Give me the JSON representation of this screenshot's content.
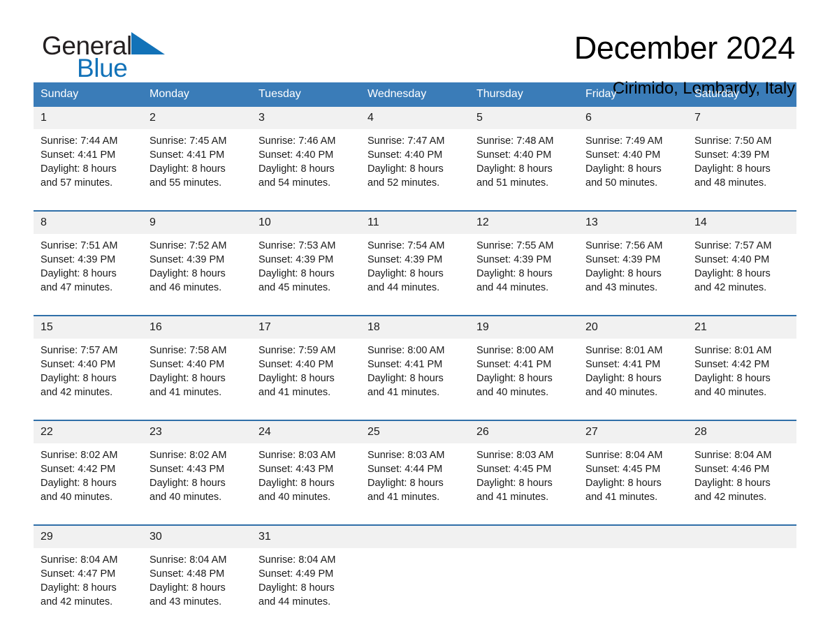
{
  "brand": {
    "name_part1": "General",
    "name_part2": "Blue",
    "mark": "triangle-logo",
    "accent_color": "#1272b8"
  },
  "header": {
    "title": "December 2024",
    "subtitle": "Cirimido, Lombardy, Italy"
  },
  "calendar": {
    "header_bg": "#3a7cb8",
    "daynum_bg": "#f1f1f1",
    "row_divider_color": "#2f6fa8",
    "weekday_headers": [
      "Sunday",
      "Monday",
      "Tuesday",
      "Wednesday",
      "Thursday",
      "Friday",
      "Saturday"
    ],
    "weeks": [
      [
        {
          "day": "1",
          "sunrise": "Sunrise: 7:44 AM",
          "sunset": "Sunset: 4:41 PM",
          "daylight_line1": "Daylight: 8 hours",
          "daylight_line2": "and 57 minutes."
        },
        {
          "day": "2",
          "sunrise": "Sunrise: 7:45 AM",
          "sunset": "Sunset: 4:41 PM",
          "daylight_line1": "Daylight: 8 hours",
          "daylight_line2": "and 55 minutes."
        },
        {
          "day": "3",
          "sunrise": "Sunrise: 7:46 AM",
          "sunset": "Sunset: 4:40 PM",
          "daylight_line1": "Daylight: 8 hours",
          "daylight_line2": "and 54 minutes."
        },
        {
          "day": "4",
          "sunrise": "Sunrise: 7:47 AM",
          "sunset": "Sunset: 4:40 PM",
          "daylight_line1": "Daylight: 8 hours",
          "daylight_line2": "and 52 minutes."
        },
        {
          "day": "5",
          "sunrise": "Sunrise: 7:48 AM",
          "sunset": "Sunset: 4:40 PM",
          "daylight_line1": "Daylight: 8 hours",
          "daylight_line2": "and 51 minutes."
        },
        {
          "day": "6",
          "sunrise": "Sunrise: 7:49 AM",
          "sunset": "Sunset: 4:40 PM",
          "daylight_line1": "Daylight: 8 hours",
          "daylight_line2": "and 50 minutes."
        },
        {
          "day": "7",
          "sunrise": "Sunrise: 7:50 AM",
          "sunset": "Sunset: 4:39 PM",
          "daylight_line1": "Daylight: 8 hours",
          "daylight_line2": "and 48 minutes."
        }
      ],
      [
        {
          "day": "8",
          "sunrise": "Sunrise: 7:51 AM",
          "sunset": "Sunset: 4:39 PM",
          "daylight_line1": "Daylight: 8 hours",
          "daylight_line2": "and 47 minutes."
        },
        {
          "day": "9",
          "sunrise": "Sunrise: 7:52 AM",
          "sunset": "Sunset: 4:39 PM",
          "daylight_line1": "Daylight: 8 hours",
          "daylight_line2": "and 46 minutes."
        },
        {
          "day": "10",
          "sunrise": "Sunrise: 7:53 AM",
          "sunset": "Sunset: 4:39 PM",
          "daylight_line1": "Daylight: 8 hours",
          "daylight_line2": "and 45 minutes."
        },
        {
          "day": "11",
          "sunrise": "Sunrise: 7:54 AM",
          "sunset": "Sunset: 4:39 PM",
          "daylight_line1": "Daylight: 8 hours",
          "daylight_line2": "and 44 minutes."
        },
        {
          "day": "12",
          "sunrise": "Sunrise: 7:55 AM",
          "sunset": "Sunset: 4:39 PM",
          "daylight_line1": "Daylight: 8 hours",
          "daylight_line2": "and 44 minutes."
        },
        {
          "day": "13",
          "sunrise": "Sunrise: 7:56 AM",
          "sunset": "Sunset: 4:39 PM",
          "daylight_line1": "Daylight: 8 hours",
          "daylight_line2": "and 43 minutes."
        },
        {
          "day": "14",
          "sunrise": "Sunrise: 7:57 AM",
          "sunset": "Sunset: 4:40 PM",
          "daylight_line1": "Daylight: 8 hours",
          "daylight_line2": "and 42 minutes."
        }
      ],
      [
        {
          "day": "15",
          "sunrise": "Sunrise: 7:57 AM",
          "sunset": "Sunset: 4:40 PM",
          "daylight_line1": "Daylight: 8 hours",
          "daylight_line2": "and 42 minutes."
        },
        {
          "day": "16",
          "sunrise": "Sunrise: 7:58 AM",
          "sunset": "Sunset: 4:40 PM",
          "daylight_line1": "Daylight: 8 hours",
          "daylight_line2": "and 41 minutes."
        },
        {
          "day": "17",
          "sunrise": "Sunrise: 7:59 AM",
          "sunset": "Sunset: 4:40 PM",
          "daylight_line1": "Daylight: 8 hours",
          "daylight_line2": "and 41 minutes."
        },
        {
          "day": "18",
          "sunrise": "Sunrise: 8:00 AM",
          "sunset": "Sunset: 4:41 PM",
          "daylight_line1": "Daylight: 8 hours",
          "daylight_line2": "and 41 minutes."
        },
        {
          "day": "19",
          "sunrise": "Sunrise: 8:00 AM",
          "sunset": "Sunset: 4:41 PM",
          "daylight_line1": "Daylight: 8 hours",
          "daylight_line2": "and 40 minutes."
        },
        {
          "day": "20",
          "sunrise": "Sunrise: 8:01 AM",
          "sunset": "Sunset: 4:41 PM",
          "daylight_line1": "Daylight: 8 hours",
          "daylight_line2": "and 40 minutes."
        },
        {
          "day": "21",
          "sunrise": "Sunrise: 8:01 AM",
          "sunset": "Sunset: 4:42 PM",
          "daylight_line1": "Daylight: 8 hours",
          "daylight_line2": "and 40 minutes."
        }
      ],
      [
        {
          "day": "22",
          "sunrise": "Sunrise: 8:02 AM",
          "sunset": "Sunset: 4:42 PM",
          "daylight_line1": "Daylight: 8 hours",
          "daylight_line2": "and 40 minutes."
        },
        {
          "day": "23",
          "sunrise": "Sunrise: 8:02 AM",
          "sunset": "Sunset: 4:43 PM",
          "daylight_line1": "Daylight: 8 hours",
          "daylight_line2": "and 40 minutes."
        },
        {
          "day": "24",
          "sunrise": "Sunrise: 8:03 AM",
          "sunset": "Sunset: 4:43 PM",
          "daylight_line1": "Daylight: 8 hours",
          "daylight_line2": "and 40 minutes."
        },
        {
          "day": "25",
          "sunrise": "Sunrise: 8:03 AM",
          "sunset": "Sunset: 4:44 PM",
          "daylight_line1": "Daylight: 8 hours",
          "daylight_line2": "and 41 minutes."
        },
        {
          "day": "26",
          "sunrise": "Sunrise: 8:03 AM",
          "sunset": "Sunset: 4:45 PM",
          "daylight_line1": "Daylight: 8 hours",
          "daylight_line2": "and 41 minutes."
        },
        {
          "day": "27",
          "sunrise": "Sunrise: 8:04 AM",
          "sunset": "Sunset: 4:45 PM",
          "daylight_line1": "Daylight: 8 hours",
          "daylight_line2": "and 41 minutes."
        },
        {
          "day": "28",
          "sunrise": "Sunrise: 8:04 AM",
          "sunset": "Sunset: 4:46 PM",
          "daylight_line1": "Daylight: 8 hours",
          "daylight_line2": "and 42 minutes."
        }
      ],
      [
        {
          "day": "29",
          "sunrise": "Sunrise: 8:04 AM",
          "sunset": "Sunset: 4:47 PM",
          "daylight_line1": "Daylight: 8 hours",
          "daylight_line2": "and 42 minutes."
        },
        {
          "day": "30",
          "sunrise": "Sunrise: 8:04 AM",
          "sunset": "Sunset: 4:48 PM",
          "daylight_line1": "Daylight: 8 hours",
          "daylight_line2": "and 43 minutes."
        },
        {
          "day": "31",
          "sunrise": "Sunrise: 8:04 AM",
          "sunset": "Sunset: 4:49 PM",
          "daylight_line1": "Daylight: 8 hours",
          "daylight_line2": "and 44 minutes."
        },
        {
          "day": "",
          "sunrise": "",
          "sunset": "",
          "daylight_line1": "",
          "daylight_line2": ""
        },
        {
          "day": "",
          "sunrise": "",
          "sunset": "",
          "daylight_line1": "",
          "daylight_line2": ""
        },
        {
          "day": "",
          "sunrise": "",
          "sunset": "",
          "daylight_line1": "",
          "daylight_line2": ""
        },
        {
          "day": "",
          "sunrise": "",
          "sunset": "",
          "daylight_line1": "",
          "daylight_line2": ""
        }
      ]
    ]
  }
}
